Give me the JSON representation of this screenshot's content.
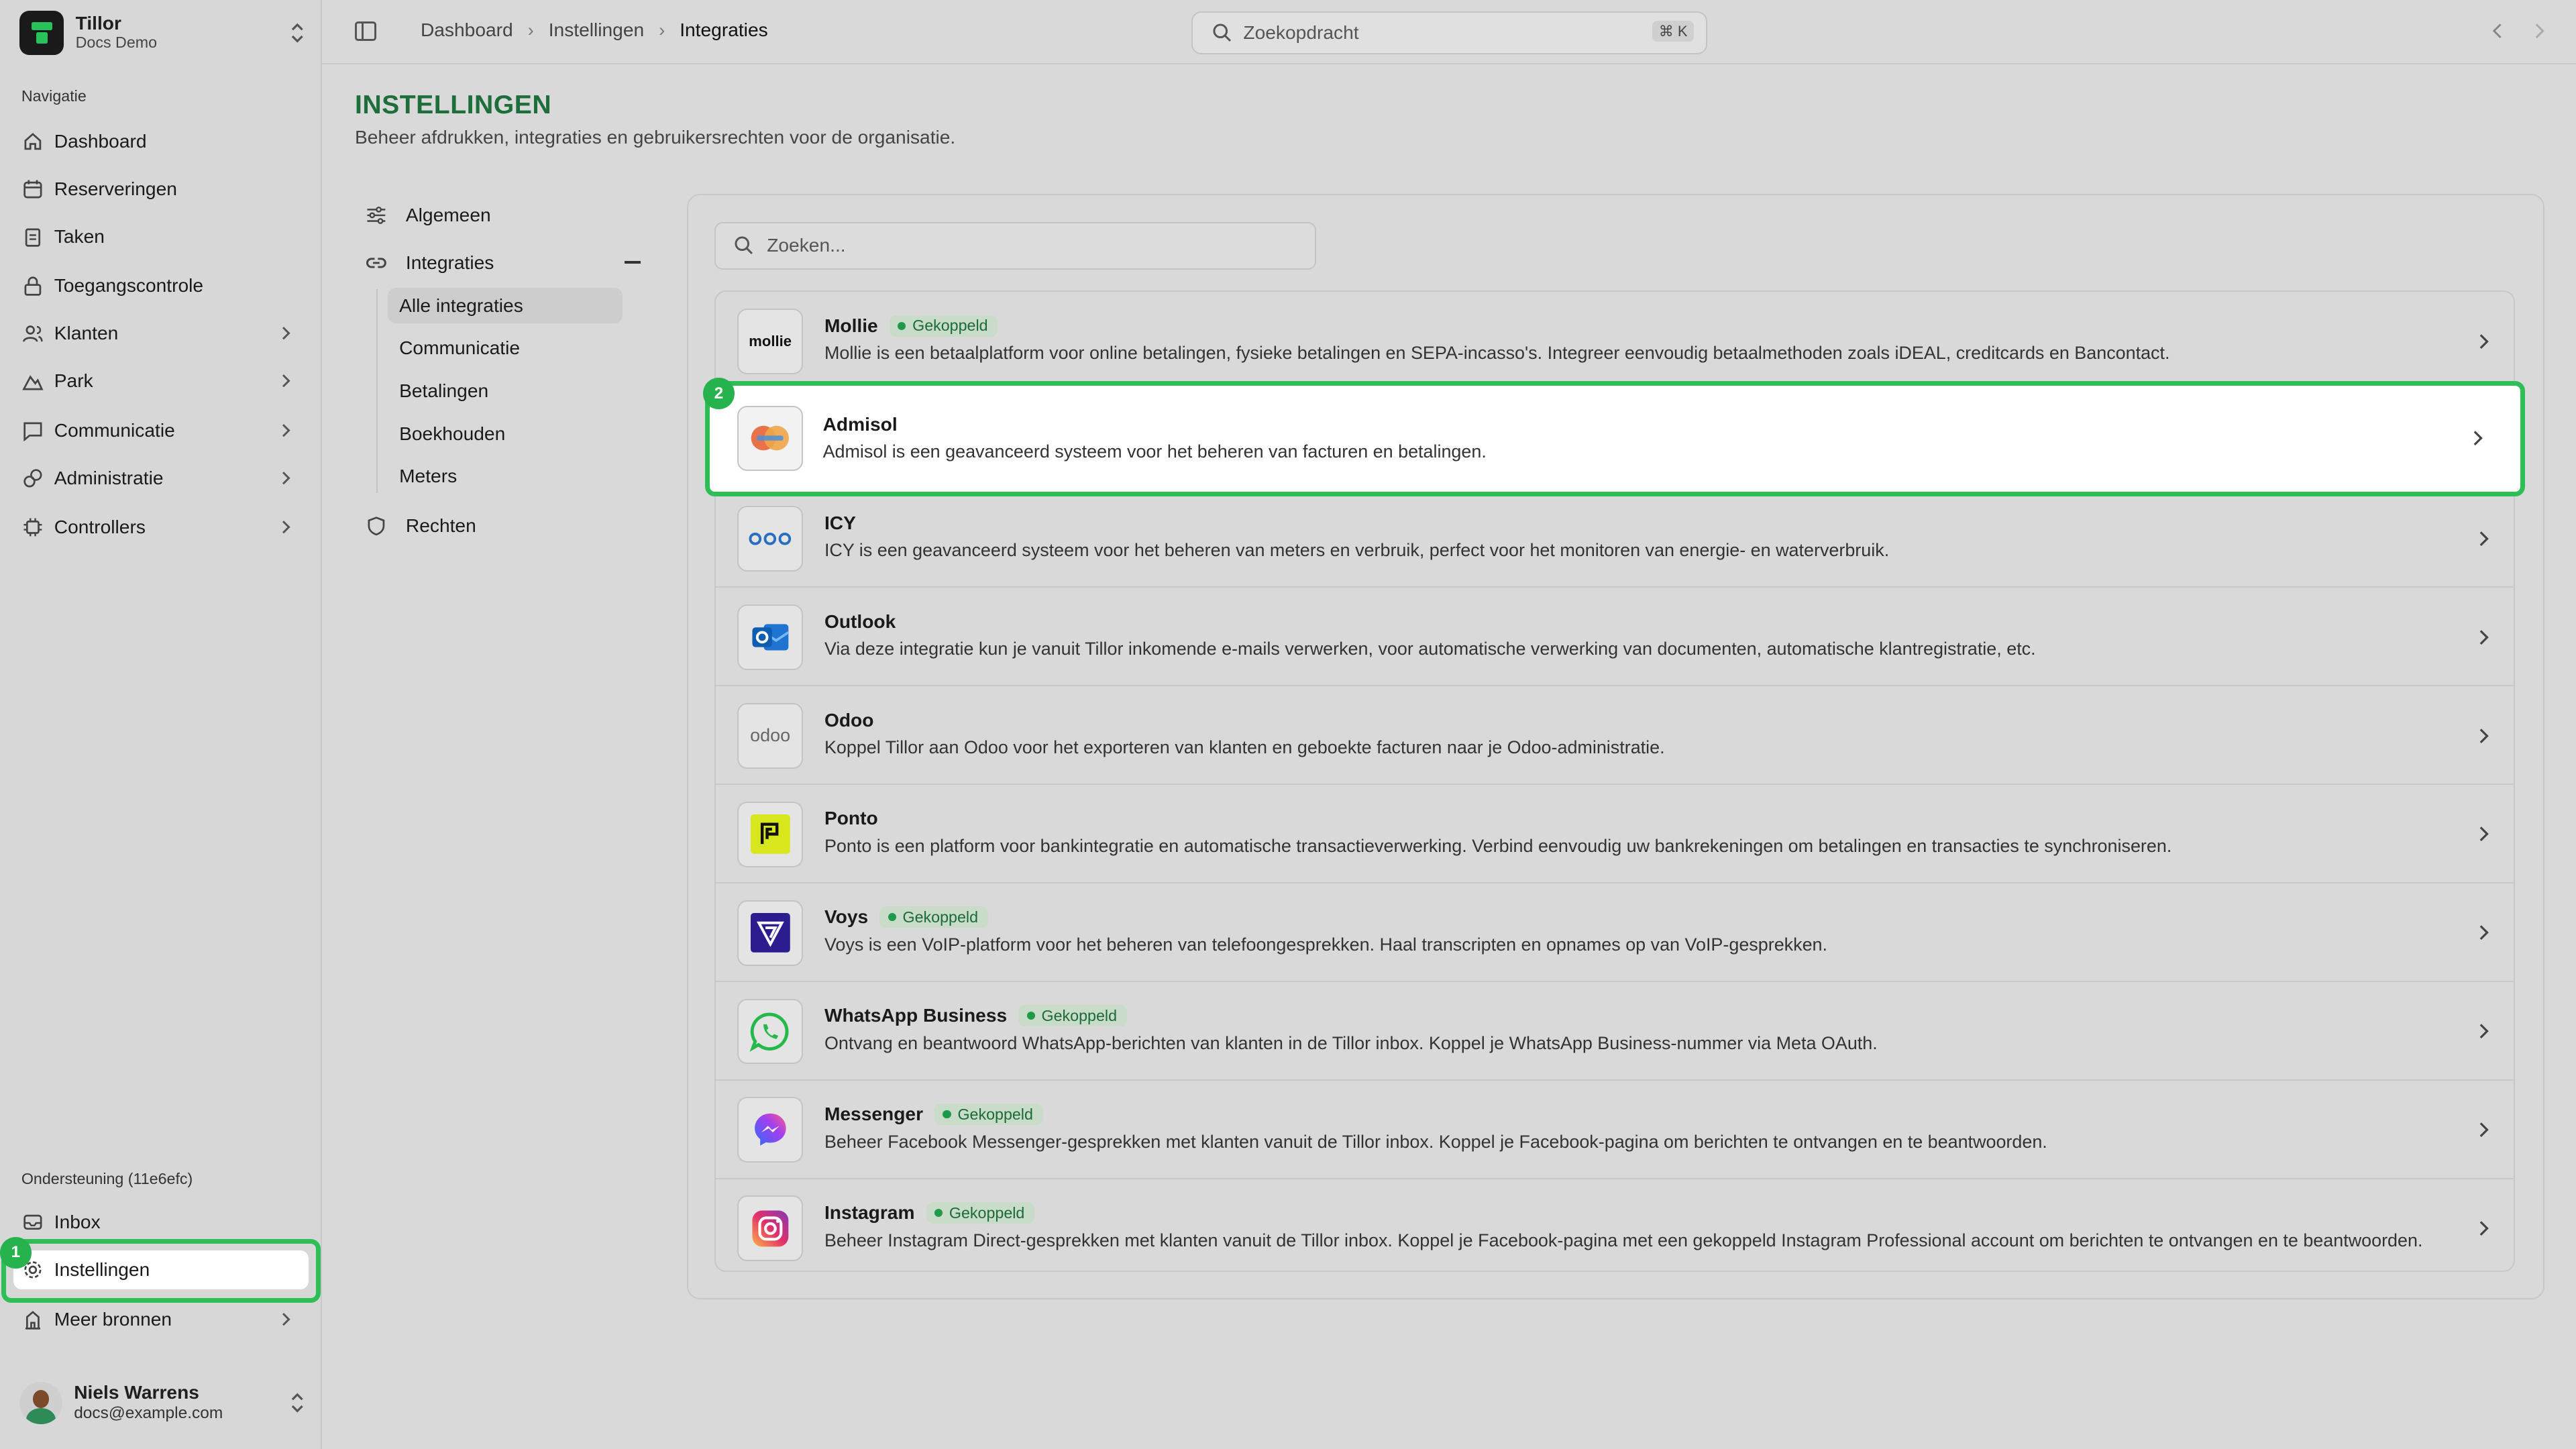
{
  "brand": {
    "title": "Tillor",
    "subtitle": "Docs Demo"
  },
  "sidebar": {
    "section_label": "Navigatie",
    "items": [
      {
        "label": "Dashboard",
        "icon": "home-icon"
      },
      {
        "label": "Reserveringen",
        "icon": "calendar-icon"
      },
      {
        "label": "Taken",
        "icon": "clipboard-icon"
      },
      {
        "label": "Toegangscontrole",
        "icon": "lock-icon"
      },
      {
        "label": "Klanten",
        "icon": "users-icon"
      },
      {
        "label": "Park",
        "icon": "park-icon"
      },
      {
        "label": "Communicatie",
        "icon": "message-icon"
      },
      {
        "label": "Administratie",
        "icon": "coins-icon"
      },
      {
        "label": "Controllers",
        "icon": "chip-icon"
      }
    ],
    "support_label": "Ondersteuning (11e6efc)",
    "support_items": [
      {
        "label": "Inbox",
        "icon": "inbox-icon"
      },
      {
        "label": "Instellingen",
        "icon": "gear-icon"
      },
      {
        "label": "Meer bronnen",
        "icon": "building-icon"
      }
    ],
    "user": {
      "name": "Niels Warrens",
      "email": "docs@example.com"
    }
  },
  "topbar": {
    "breadcrumb": [
      "Dashboard",
      "Instellingen",
      "Integraties"
    ],
    "search_placeholder": "Zoekopdracht",
    "shortcut": "⌘ K"
  },
  "page": {
    "title": "INSTELLINGEN",
    "subtitle": "Beheer afdrukken, integraties en gebruikersrechten voor de organisatie."
  },
  "settings_nav": {
    "algemeen": "Algemeen",
    "integraties": "Integraties",
    "sub": [
      "Alle integraties",
      "Communicatie",
      "Betalingen",
      "Boekhouden",
      "Meters"
    ],
    "rechten": "Rechten"
  },
  "integrations": {
    "search_placeholder": "Zoeken...",
    "badge_label": "Gekoppeld",
    "items": [
      {
        "name": "Mollie",
        "linked": true,
        "logo_text": "mollie",
        "desc": "Mollie is een betaalplatform voor online betalingen, fysieke betalingen en SEPA-incasso's. Integreer eenvoudig betaalmethoden zoals iDEAL, creditcards en Bancontact."
      },
      {
        "name": "Admisol",
        "linked": false,
        "desc": "Admisol is een geavanceerd systeem voor het beheren van facturen en betalingen."
      },
      {
        "name": "ICY",
        "linked": false,
        "desc": "ICY is een geavanceerd systeem voor het beheren van meters en verbruik, perfect voor het monitoren van energie- en waterverbruik."
      },
      {
        "name": "Outlook",
        "linked": false,
        "desc": "Via deze integratie kun je vanuit Tillor inkomende e-mails verwerken, voor automatische verwerking van documenten, automatische klantregistratie, etc."
      },
      {
        "name": "Odoo",
        "linked": false,
        "logo_text": "odoo",
        "desc": "Koppel Tillor aan Odoo voor het exporteren van klanten en geboekte facturen naar je Odoo-administratie."
      },
      {
        "name": "Ponto",
        "linked": false,
        "desc": "Ponto is een platform voor bankintegratie en automatische transactieverwerking. Verbind eenvoudig uw bankrekeningen om betalingen en transacties te synchroniseren."
      },
      {
        "name": "Voys",
        "linked": true,
        "desc": "Voys is een VoIP-platform voor het beheren van telefoongesprekken. Haal transcripten en opnames op van VoIP-gesprekken."
      },
      {
        "name": "WhatsApp Business",
        "linked": true,
        "desc": "Ontvang en beantwoord WhatsApp-berichten van klanten in de Tillor inbox. Koppel je WhatsApp Business-nummer via Meta OAuth."
      },
      {
        "name": "Messenger",
        "linked": true,
        "desc": "Beheer Facebook Messenger-gesprekken met klanten vanuit de Tillor inbox. Koppel je Facebook-pagina om berichten te ontvangen en te beantwoorden."
      },
      {
        "name": "Instagram",
        "linked": true,
        "desc": "Beheer Instagram Direct-gesprekken met klanten vanuit de Tillor inbox. Koppel je Facebook-pagina met een gekoppeld Instagram Professional account om berichten te ontvangen en te beantwoorden."
      }
    ]
  },
  "annotations": {
    "step1": "1",
    "step2": "2"
  },
  "colors": {
    "accent": "#2dbe55",
    "title_green": "#1e6e3c",
    "badge_bg": "#c8dcc9"
  }
}
